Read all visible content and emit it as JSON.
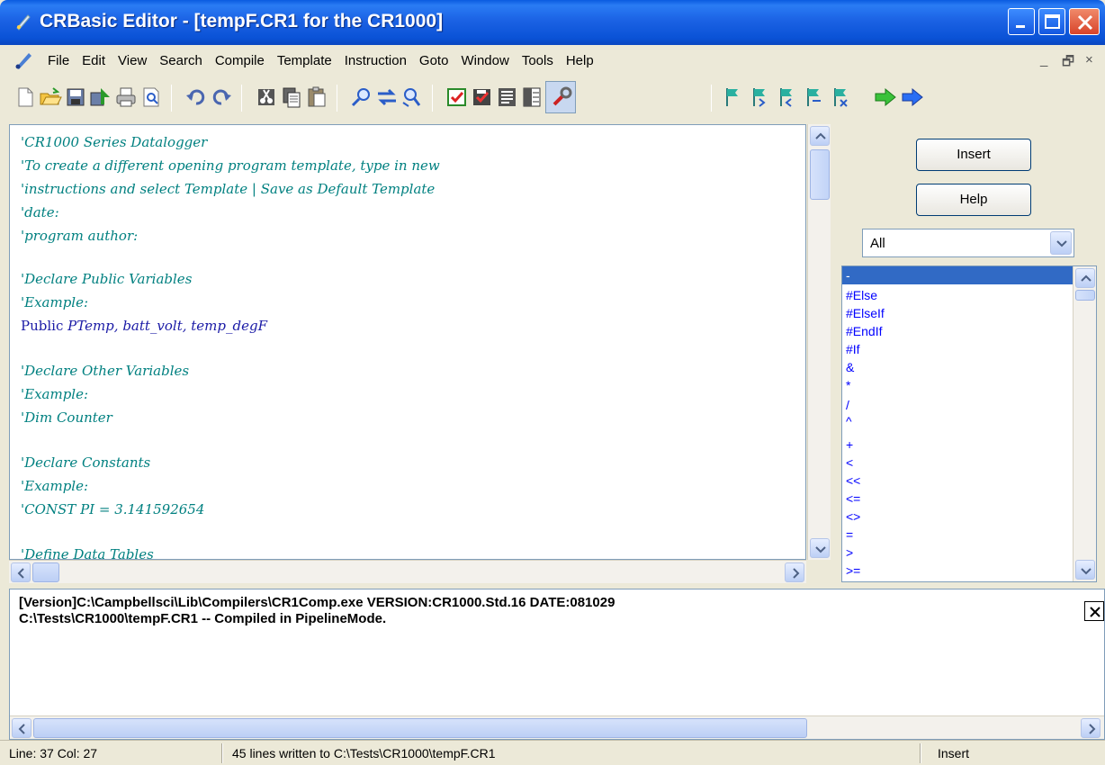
{
  "window": {
    "title": "CRBasic Editor - [tempF.CR1 for the CR1000]",
    "minimize_glyph": "_",
    "restore_glyph": "☐",
    "close_glyph": "✕"
  },
  "menubar": {
    "items": [
      "File",
      "Edit",
      "View",
      "Search",
      "Compile",
      "Template",
      "Instruction",
      "Goto",
      "Window",
      "Tools",
      "Help"
    ],
    "mdi_minimize": "_",
    "mdi_restore": "🗗",
    "mdi_close": "×"
  },
  "toolbar": {
    "icons": [
      "new-file-icon",
      "open-folder-icon",
      "save-icon",
      "save-and-compile-icon",
      "print-icon",
      "print-preview-icon",
      "undo-icon",
      "redo-icon",
      "cut-icon",
      "copy-icon",
      "paste-icon",
      "find-icon",
      "replace-icon",
      "find-next-icon",
      "compile-icon",
      "save-compile-icon",
      "program-icon",
      "table-icon",
      "tools-wrench-icon",
      "bookmark-toggle-icon",
      "bookmark-next-icon",
      "bookmark-prev-icon",
      "bookmark-clear-icon",
      "bookmark-list-icon",
      "back-arrow-icon",
      "forward-arrow-icon"
    ],
    "pressed": "tools-wrench-icon"
  },
  "editor": {
    "lines": [
      {
        "text": "'CR1000 Series Datalogger",
        "kind": "comment"
      },
      {
        "text": "'To create a different opening program template, type in new",
        "kind": "comment"
      },
      {
        "text": "'instructions and select Template | Save as Default Template",
        "kind": "comment"
      },
      {
        "text": "'date:",
        "kind": "comment"
      },
      {
        "text": "'program author:",
        "kind": "comment"
      },
      {
        "text": "",
        "kind": "blank"
      },
      {
        "text": "'Declare Public Variables",
        "kind": "comment"
      },
      {
        "text": "'Example:",
        "kind": "comment"
      },
      {
        "keyword": "Public",
        "rest": "PTemp, batt_volt, temp_degF",
        "kind": "code"
      },
      {
        "text": "",
        "kind": "blank"
      },
      {
        "text": "'Declare Other Variables",
        "kind": "comment"
      },
      {
        "text": "'Example:",
        "kind": "comment"
      },
      {
        "text": "'Dim Counter",
        "kind": "comment"
      },
      {
        "text": "",
        "kind": "blank"
      },
      {
        "text": "'Declare Constants",
        "kind": "comment"
      },
      {
        "text": "'Example:",
        "kind": "comment"
      },
      {
        "text": "'CONST PI = 3.141592654",
        "kind": "comment"
      },
      {
        "text": "",
        "kind": "blank"
      },
      {
        "text": "'Define Data Tables",
        "kind": "comment"
      }
    ]
  },
  "instruction_panel": {
    "insert_label": "Insert",
    "help_label": "Help",
    "filter_value": "All",
    "items": [
      "-",
      "#Else",
      "#ElseIf",
      "#EndIf",
      "#If",
      "&",
      "*",
      "/",
      "^",
      "+",
      "<",
      "<<",
      "<=",
      "<>",
      "=",
      ">",
      ">="
    ],
    "selected_index": 0
  },
  "output": {
    "lines": [
      "[Version]C:\\Campbellsci\\Lib\\Compilers\\CR1Comp.exe VERSION:CR1000.Std.16  DATE:081029",
      "C:\\Tests\\CR1000\\tempF.CR1 -- Compiled in PipelineMode."
    ]
  },
  "statusbar": {
    "position": "Line: 37 Col: 27",
    "message": "45 lines written to C:\\Tests\\CR1000\\tempF.CR1",
    "mode": "Insert"
  },
  "colors": {
    "comment": "#008080",
    "code": "#1a1aa6",
    "instruction": "#0000ff",
    "selection": "#316ac5",
    "titlebar": "#0a52d6"
  }
}
